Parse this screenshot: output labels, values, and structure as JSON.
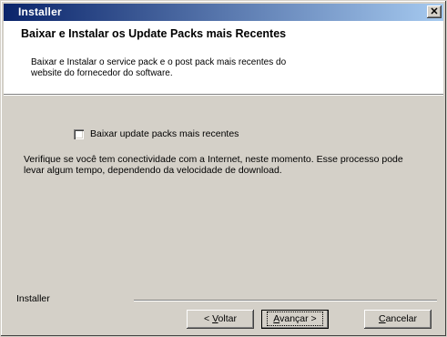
{
  "window": {
    "title": "Installer",
    "close_glyph": "✕"
  },
  "header": {
    "title": "Baixar e Instalar os Update Packs mais Recentes",
    "subtitle": "Baixar e Instalar o service pack e o post pack mais recentes do website do fornecedor do software."
  },
  "content": {
    "checkbox_label": "Baixar update packs mais recentes",
    "checkbox_checked": false,
    "description": "Verifique se você tem conectividade com a Internet, neste momento. Esse processo pode levar algum tempo, dependendo da velocidade de download."
  },
  "footer": {
    "branding": "Installer",
    "back_prefix": "< ",
    "back_mnemonic": "V",
    "back_rest": "oltar",
    "next_mnemonic": "A",
    "next_rest": "vançar >",
    "cancel_mnemonic": "C",
    "cancel_rest": "ancelar"
  },
  "colors": {
    "title_bar_start": "#0a246a",
    "title_bar_end": "#a6caf0",
    "face": "#d4d0c8",
    "header_bg": "#ffffff"
  }
}
